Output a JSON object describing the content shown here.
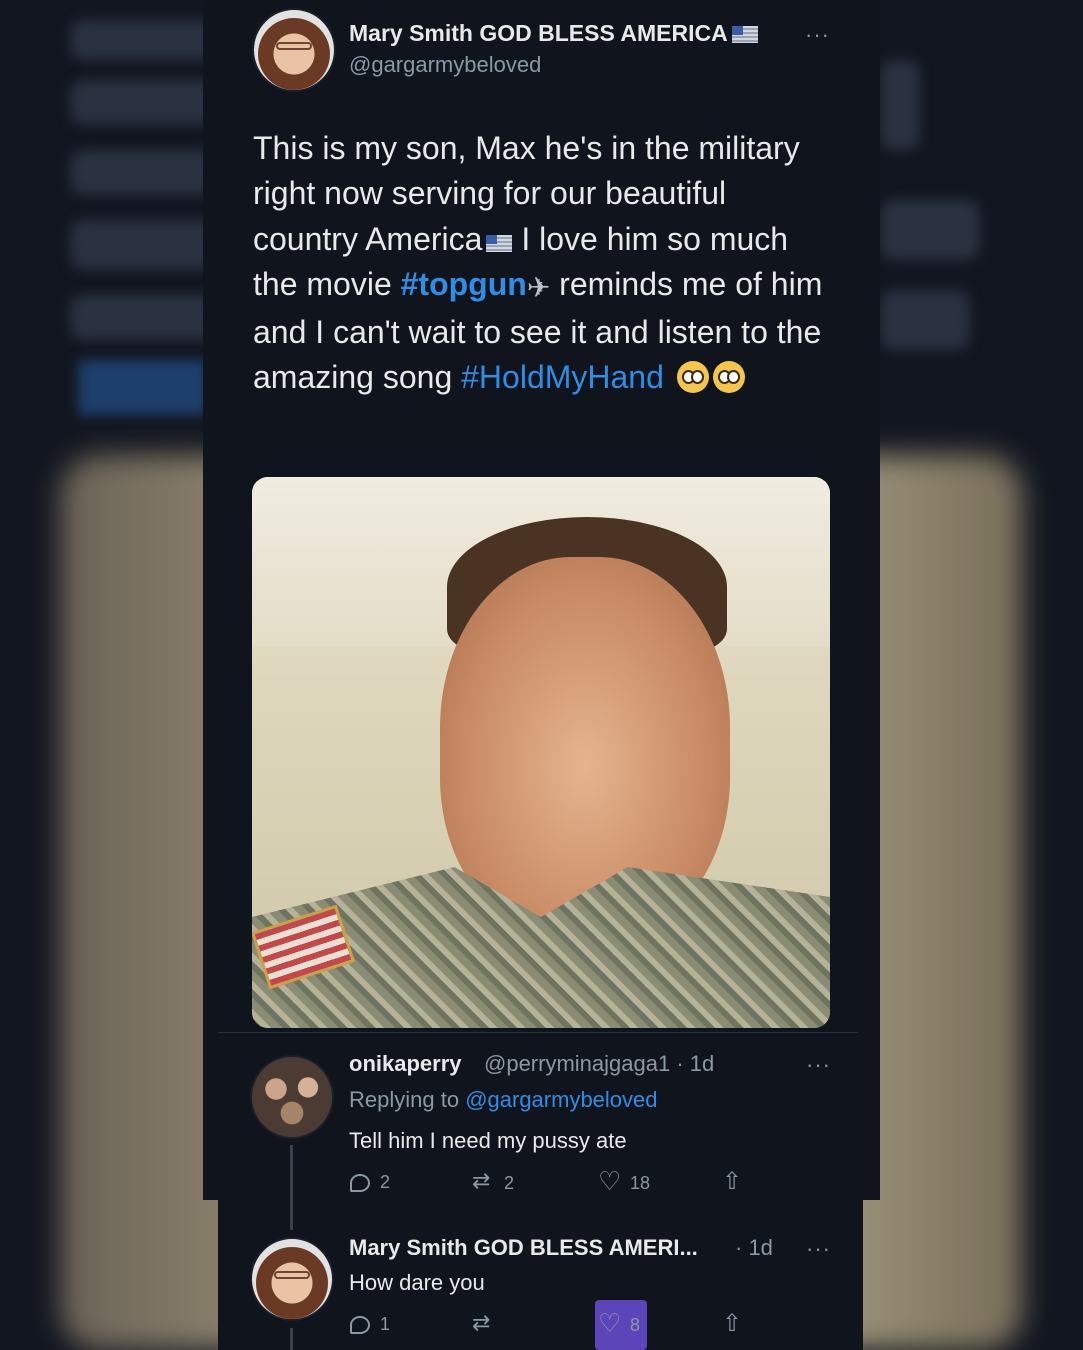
{
  "tweet": {
    "author_name": "Mary Smith GOD BLESS AMERICA",
    "author_handle": "@gargarmybeloved",
    "more": "···",
    "text_1": "This is my son, Max he's in the military right now serving for our beautiful country America",
    "text_2": " I love him so much the movie ",
    "hashtag_1": "#topgun",
    "text_3": " reminds me of him and I can't wait to see it and listen to the amazing song ",
    "hashtag_2": "#HoldMyHand"
  },
  "reply_1": {
    "name": "onikaperry",
    "meta": "@perryminajgaga1 · 1d",
    "replying_label": "Replying to ",
    "replying_to": "@gargarmybeloved",
    "text": "Tell him I need my pussy ate",
    "more": "···",
    "reply_count": "2",
    "retweet_count": "2",
    "like_count": "18"
  },
  "reply_2": {
    "name": "Mary Smith GOD BLESS AMERI...",
    "meta": " · 1d",
    "text": "How dare you",
    "more": "···",
    "reply_count": "1",
    "retweet_count": "",
    "like_count": "8"
  },
  "icons": {
    "flag": "us-flag-icon",
    "jet": "airplane-icon",
    "emoji": "pleading-face-icon",
    "reply": "reply-icon",
    "retweet": "retweet-icon",
    "like": "heart-icon",
    "share": "share-icon"
  },
  "colors": {
    "background": "#10141c",
    "hashtag": "#2f8de4",
    "muted": "#8b98a5",
    "like_highlight": "#5c45b8"
  }
}
